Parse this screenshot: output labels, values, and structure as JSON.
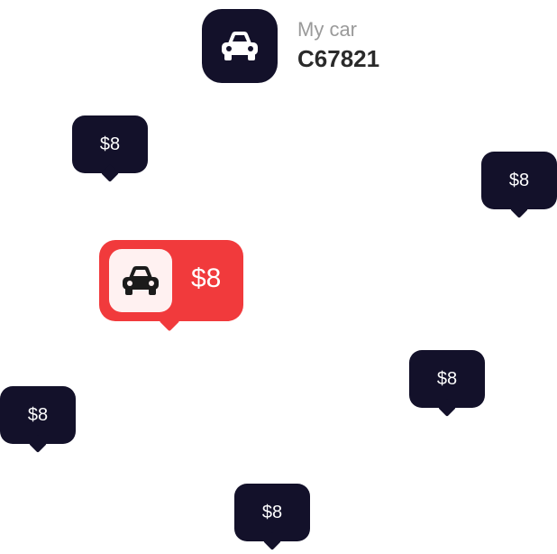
{
  "header": {
    "icon": "car-icon",
    "label": "My car",
    "plate": "C67821"
  },
  "pins": [
    {
      "price": "$8"
    },
    {
      "price": "$8"
    },
    {
      "price": "$8"
    },
    {
      "price": "$8"
    },
    {
      "price": "$8"
    },
    {
      "price": "$8"
    }
  ],
  "selected_pin": {
    "icon": "car-icon",
    "price": "$8"
  },
  "colors": {
    "dark": "#13112a",
    "accent": "#f13a3c",
    "icon_bg_light": "#fff1f1"
  }
}
